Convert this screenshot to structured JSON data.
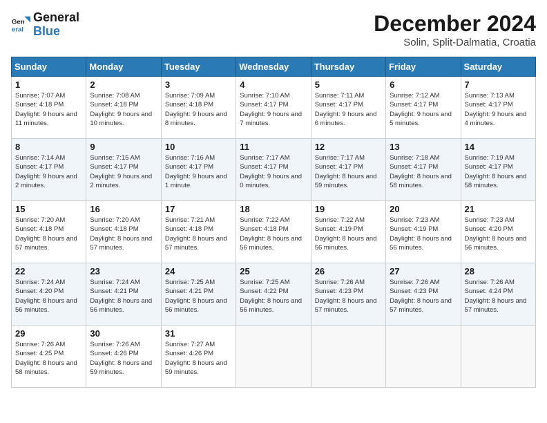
{
  "logo": {
    "line1": "General",
    "line2": "Blue"
  },
  "title": "December 2024",
  "location": "Solin, Split-Dalmatia, Croatia",
  "days_of_week": [
    "Sunday",
    "Monday",
    "Tuesday",
    "Wednesday",
    "Thursday",
    "Friday",
    "Saturday"
  ],
  "weeks": [
    [
      {
        "day": "1",
        "sunrise": "Sunrise: 7:07 AM",
        "sunset": "Sunset: 4:18 PM",
        "daylight": "Daylight: 9 hours and 11 minutes."
      },
      {
        "day": "2",
        "sunrise": "Sunrise: 7:08 AM",
        "sunset": "Sunset: 4:18 PM",
        "daylight": "Daylight: 9 hours and 10 minutes."
      },
      {
        "day": "3",
        "sunrise": "Sunrise: 7:09 AM",
        "sunset": "Sunset: 4:18 PM",
        "daylight": "Daylight: 9 hours and 8 minutes."
      },
      {
        "day": "4",
        "sunrise": "Sunrise: 7:10 AM",
        "sunset": "Sunset: 4:17 PM",
        "daylight": "Daylight: 9 hours and 7 minutes."
      },
      {
        "day": "5",
        "sunrise": "Sunrise: 7:11 AM",
        "sunset": "Sunset: 4:17 PM",
        "daylight": "Daylight: 9 hours and 6 minutes."
      },
      {
        "day": "6",
        "sunrise": "Sunrise: 7:12 AM",
        "sunset": "Sunset: 4:17 PM",
        "daylight": "Daylight: 9 hours and 5 minutes."
      },
      {
        "day": "7",
        "sunrise": "Sunrise: 7:13 AM",
        "sunset": "Sunset: 4:17 PM",
        "daylight": "Daylight: 9 hours and 4 minutes."
      }
    ],
    [
      {
        "day": "8",
        "sunrise": "Sunrise: 7:14 AM",
        "sunset": "Sunset: 4:17 PM",
        "daylight": "Daylight: 9 hours and 2 minutes."
      },
      {
        "day": "9",
        "sunrise": "Sunrise: 7:15 AM",
        "sunset": "Sunset: 4:17 PM",
        "daylight": "Daylight: 9 hours and 2 minutes."
      },
      {
        "day": "10",
        "sunrise": "Sunrise: 7:16 AM",
        "sunset": "Sunset: 4:17 PM",
        "daylight": "Daylight: 9 hours and 1 minute."
      },
      {
        "day": "11",
        "sunrise": "Sunrise: 7:17 AM",
        "sunset": "Sunset: 4:17 PM",
        "daylight": "Daylight: 9 hours and 0 minutes."
      },
      {
        "day": "12",
        "sunrise": "Sunrise: 7:17 AM",
        "sunset": "Sunset: 4:17 PM",
        "daylight": "Daylight: 8 hours and 59 minutes."
      },
      {
        "day": "13",
        "sunrise": "Sunrise: 7:18 AM",
        "sunset": "Sunset: 4:17 PM",
        "daylight": "Daylight: 8 hours and 58 minutes."
      },
      {
        "day": "14",
        "sunrise": "Sunrise: 7:19 AM",
        "sunset": "Sunset: 4:17 PM",
        "daylight": "Daylight: 8 hours and 58 minutes."
      }
    ],
    [
      {
        "day": "15",
        "sunrise": "Sunrise: 7:20 AM",
        "sunset": "Sunset: 4:18 PM",
        "daylight": "Daylight: 8 hours and 57 minutes."
      },
      {
        "day": "16",
        "sunrise": "Sunrise: 7:20 AM",
        "sunset": "Sunset: 4:18 PM",
        "daylight": "Daylight: 8 hours and 57 minutes."
      },
      {
        "day": "17",
        "sunrise": "Sunrise: 7:21 AM",
        "sunset": "Sunset: 4:18 PM",
        "daylight": "Daylight: 8 hours and 57 minutes."
      },
      {
        "day": "18",
        "sunrise": "Sunrise: 7:22 AM",
        "sunset": "Sunset: 4:18 PM",
        "daylight": "Daylight: 8 hours and 56 minutes."
      },
      {
        "day": "19",
        "sunrise": "Sunrise: 7:22 AM",
        "sunset": "Sunset: 4:19 PM",
        "daylight": "Daylight: 8 hours and 56 minutes."
      },
      {
        "day": "20",
        "sunrise": "Sunrise: 7:23 AM",
        "sunset": "Sunset: 4:19 PM",
        "daylight": "Daylight: 8 hours and 56 minutes."
      },
      {
        "day": "21",
        "sunrise": "Sunrise: 7:23 AM",
        "sunset": "Sunset: 4:20 PM",
        "daylight": "Daylight: 8 hours and 56 minutes."
      }
    ],
    [
      {
        "day": "22",
        "sunrise": "Sunrise: 7:24 AM",
        "sunset": "Sunset: 4:20 PM",
        "daylight": "Daylight: 8 hours and 56 minutes."
      },
      {
        "day": "23",
        "sunrise": "Sunrise: 7:24 AM",
        "sunset": "Sunset: 4:21 PM",
        "daylight": "Daylight: 8 hours and 56 minutes."
      },
      {
        "day": "24",
        "sunrise": "Sunrise: 7:25 AM",
        "sunset": "Sunset: 4:21 PM",
        "daylight": "Daylight: 8 hours and 56 minutes."
      },
      {
        "day": "25",
        "sunrise": "Sunrise: 7:25 AM",
        "sunset": "Sunset: 4:22 PM",
        "daylight": "Daylight: 8 hours and 56 minutes."
      },
      {
        "day": "26",
        "sunrise": "Sunrise: 7:26 AM",
        "sunset": "Sunset: 4:23 PM",
        "daylight": "Daylight: 8 hours and 57 minutes."
      },
      {
        "day": "27",
        "sunrise": "Sunrise: 7:26 AM",
        "sunset": "Sunset: 4:23 PM",
        "daylight": "Daylight: 8 hours and 57 minutes."
      },
      {
        "day": "28",
        "sunrise": "Sunrise: 7:26 AM",
        "sunset": "Sunset: 4:24 PM",
        "daylight": "Daylight: 8 hours and 57 minutes."
      }
    ],
    [
      {
        "day": "29",
        "sunrise": "Sunrise: 7:26 AM",
        "sunset": "Sunset: 4:25 PM",
        "daylight": "Daylight: 8 hours and 58 minutes."
      },
      {
        "day": "30",
        "sunrise": "Sunrise: 7:26 AM",
        "sunset": "Sunset: 4:26 PM",
        "daylight": "Daylight: 8 hours and 59 minutes."
      },
      {
        "day": "31",
        "sunrise": "Sunrise: 7:27 AM",
        "sunset": "Sunset: 4:26 PM",
        "daylight": "Daylight: 8 hours and 59 minutes."
      },
      null,
      null,
      null,
      null
    ]
  ]
}
